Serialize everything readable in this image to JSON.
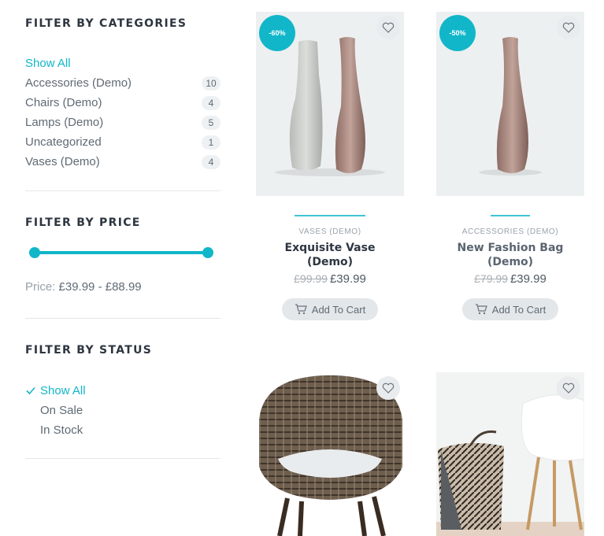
{
  "filters": {
    "categories": {
      "title": "FILTER BY CATEGORIES",
      "items": [
        {
          "label": "Show All",
          "count": null
        },
        {
          "label": "Accessories (Demo)",
          "count": "10"
        },
        {
          "label": "Chairs (Demo)",
          "count": "4"
        },
        {
          "label": "Lamps (Demo)",
          "count": "5"
        },
        {
          "label": "Uncategorized",
          "count": "1"
        },
        {
          "label": "Vases (Demo)",
          "count": "4"
        }
      ]
    },
    "price": {
      "title": "FILTER BY PRICE",
      "label": "Price:",
      "min": "£39.99",
      "sep": "-",
      "max": "£88.99"
    },
    "status": {
      "title": "FILTER BY STATUS",
      "items": [
        {
          "label": "Show All"
        },
        {
          "label": "On Sale"
        },
        {
          "label": "In Stock"
        }
      ]
    }
  },
  "products": [
    {
      "badge": "-60%",
      "category": "VASES (DEMO)",
      "title_line1": "Exquisite Vase",
      "title_line2": "(Demo)",
      "old_price": "£99.99",
      "price": "£39.99",
      "button": "Add To Cart"
    },
    {
      "badge": "-50%",
      "category": "ACCESSORIES (DEMO)",
      "title_line1": "New Fashion Bag",
      "title_line2": "(Demo)",
      "old_price": "£79.99",
      "price": "£39.99",
      "button": "Add To Cart"
    },
    {},
    {}
  ],
  "colors": {
    "accent": "#11b6c9",
    "heading": "#2d3640",
    "text": "#5f6a74"
  }
}
